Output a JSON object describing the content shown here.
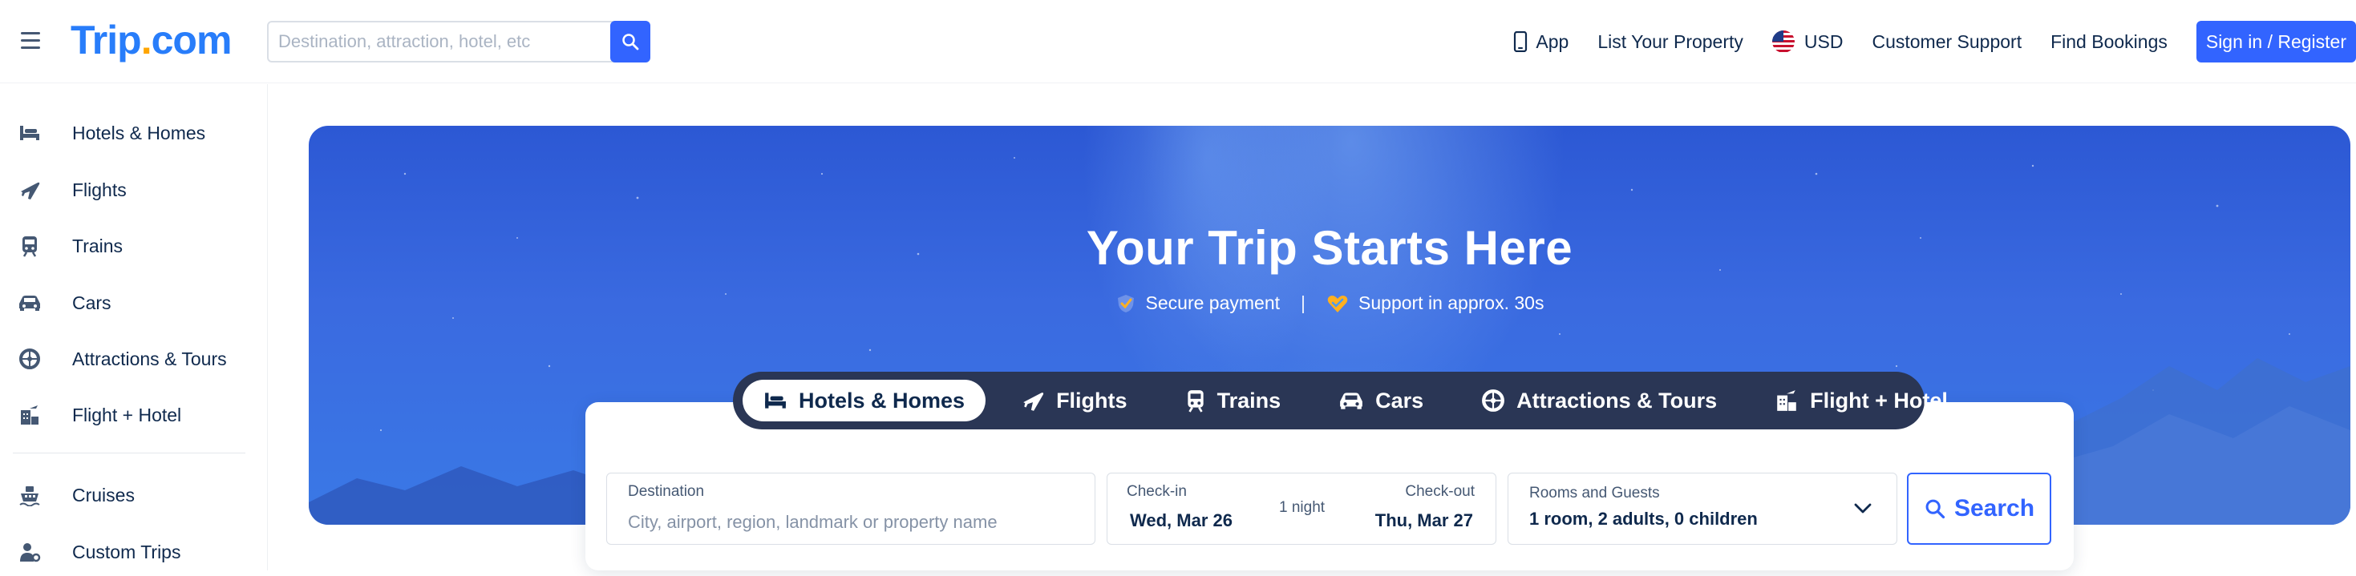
{
  "header": {
    "logo_text": "Trip",
    "logo_dot": ".",
    "logo_suffix": "com",
    "search_placeholder": "Destination, attraction, hotel, etc",
    "nav": {
      "app": "App",
      "list_property": "List Your Property",
      "currency": "USD",
      "support": "Customer Support",
      "bookings": "Find Bookings",
      "signin": "Sign in / Register"
    }
  },
  "sidebar": {
    "items": [
      {
        "label": "Hotels & Homes",
        "icon": "bed-icon"
      },
      {
        "label": "Flights",
        "icon": "plane-icon"
      },
      {
        "label": "Trains",
        "icon": "train-icon"
      },
      {
        "label": "Cars",
        "icon": "car-icon"
      },
      {
        "label": "Attractions & Tours",
        "icon": "attractions-icon"
      },
      {
        "label": "Flight + Hotel",
        "icon": "flight-hotel-icon"
      },
      {
        "label": "Cruises",
        "icon": "cruise-icon"
      },
      {
        "label": "Custom Trips",
        "icon": "custom-trips-icon"
      }
    ]
  },
  "hero": {
    "title": "Your Trip Starts Here",
    "badge_1": "Secure payment",
    "separator": "|",
    "badge_2": "Support in approx. 30s"
  },
  "tabs": [
    {
      "label": "Hotels & Homes",
      "active": true
    },
    {
      "label": "Flights",
      "active": false
    },
    {
      "label": "Trains",
      "active": false
    },
    {
      "label": "Cars",
      "active": false
    },
    {
      "label": "Attractions & Tours",
      "active": false
    },
    {
      "label": "Flight + Hotel",
      "active": false
    }
  ],
  "search_form": {
    "destination_label": "Destination",
    "destination_placeholder": "City, airport, region, landmark or property name",
    "checkin_label": "Check-in",
    "checkin_value": "Wed, Mar 26",
    "nights": "1 night",
    "checkout_label": "Check-out",
    "checkout_value": "Thu, Mar 27",
    "guests_label": "Rooms and Guests",
    "guests_value": "1 room, 2 adults, 0 children",
    "search_button": "Search"
  },
  "colors": {
    "brand_blue": "#3264ff",
    "logo_blue": "#287dfa",
    "logo_dot": "#ffa500",
    "text_dark": "#0f294d",
    "tabs_bg": "#2a3655"
  }
}
